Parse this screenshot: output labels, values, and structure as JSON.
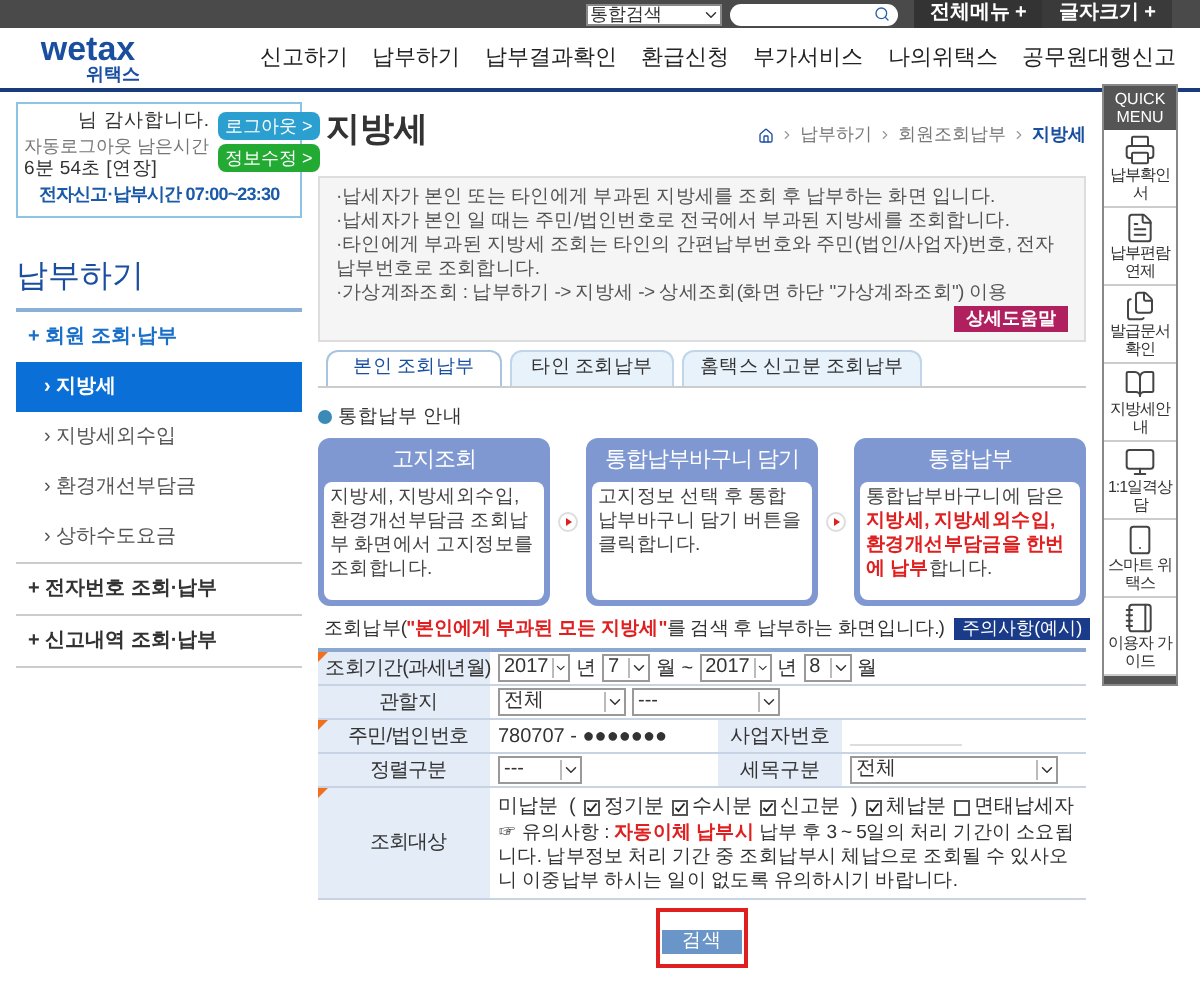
{
  "top_bar": {
    "search_scope": "통합검색",
    "buttons": [
      "전체메뉴 +",
      "글자크기 +"
    ]
  },
  "logo": {
    "text": "wetax",
    "sub": "위택스"
  },
  "nav": [
    "신고하기",
    "납부하기",
    "납부결과확인",
    "환급신청",
    "부가서비스",
    "나의위택스",
    "공무원대행신고"
  ],
  "login_box": {
    "greeting": "님 감사합니다.",
    "auto_logout": "자동로그아웃 남은시간",
    "remaining": "6분 54초 [연장]",
    "hours": "전자신고·납부시간 07:00~23:30",
    "buttons": [
      {
        "label": "로그아웃 >",
        "color": "#2a9fd0"
      },
      {
        "label": "정보수정 >",
        "color": "#22aa33"
      }
    ]
  },
  "sidebar": {
    "title": "납부하기",
    "items": [
      {
        "label": "+ 회원 조회·납부",
        "expanded": true,
        "children": [
          {
            "label": "› 지방세",
            "selected": true
          },
          {
            "label": "› 지방세외수입",
            "selected": false
          },
          {
            "label": "› 환경개선부담금",
            "selected": false
          },
          {
            "label": "› 상하수도요금",
            "selected": false
          }
        ]
      },
      {
        "label": "+ 전자번호 조회·납부",
        "expanded": false
      },
      {
        "label": "+ 신고내역 조회·납부",
        "expanded": false
      }
    ]
  },
  "page_title": "지방세",
  "breadcrumb": [
    "납부하기",
    "회원조회납부",
    "지방세"
  ],
  "info": {
    "bullets": [
      "·납세자가 본인 또는 타인에게 부과된 지방세를 조회 후 납부하는 화면 입니다.",
      "·납세자가 본인 일 때는 주민/법인번호로 전국에서 부과된 지방세를 조회합니다.",
      "·타인에게 부과된 지방세 조회는 타인의 간편납부번호와 주민(법인/사업자)번호, 전자납부번호로 조회합니다.",
      "·가상계좌조회 : 납부하기 -> 지방세 -> 상세조회(화면 하단 \"가상계좌조회\") 이용"
    ],
    "help_button": "상세도움말"
  },
  "tabs": [
    {
      "label": "본인 조회납부",
      "selected": true
    },
    {
      "label": "타인 조회납부",
      "selected": false
    },
    {
      "label": "홈택스 신고분 조회납부",
      "selected": false
    }
  ],
  "guide": {
    "title": "통합납부 안내",
    "steps": [
      {
        "title": "고지조회",
        "text": [
          {
            "t": "지방세, 지방세외수입, 환경개선부담금 조회납부 화면에서 고지정보를 조회합니다.",
            "emph": false
          }
        ]
      },
      {
        "title": "통합납부바구니 담기",
        "text": [
          {
            "t": "고지정보 선택 후 통합납부바구니 담기 버튼을 클릭합니다.",
            "emph": false
          }
        ]
      },
      {
        "title": "통합납부",
        "text": [
          {
            "t": "통합납부바구니에 담은 ",
            "emph": false
          },
          {
            "t": "지방세, 지방세외수입, 환경개선부담금을 한번에 납부",
            "emph": true
          },
          {
            "t": "합니다.",
            "emph": false
          }
        ]
      }
    ]
  },
  "form": {
    "heading": [
      {
        "t": "조회납부(",
        "emph": false
      },
      {
        "t": "\"본인에게 부과된 모든 지방세\"",
        "emph": true
      },
      {
        "t": "를 검색 후 납부하는 화면입니다.)",
        "emph": false
      }
    ],
    "notice_button": "주의사항(예시)",
    "period": {
      "label": "조회기간(과세년월)",
      "required": true,
      "from_year": "2017",
      "year_unit_1": "년",
      "from_month": "7",
      "month_unit_1": "월 ~",
      "to_year": "2017",
      "year_unit_2": "년",
      "to_month": "8",
      "month_unit_2": "월"
    },
    "jurisdiction": {
      "label": "관할지",
      "required": false,
      "values": [
        "전체",
        "---"
      ]
    },
    "id_number": {
      "label": "주민/법인번호",
      "required": true,
      "value": "780707 - ●●●●●●●",
      "business_label": "사업자번호"
    },
    "sort": {
      "label": "정렬구분",
      "required": false,
      "value": "---",
      "tax_label": "세목구분",
      "tax_value": "전체"
    },
    "target": {
      "label": "조회대상",
      "required": true,
      "options": [
        {
          "kind": "text",
          "label": "미납분  ("
        },
        {
          "kind": "checkbox",
          "label": "정기분",
          "checked": true
        },
        {
          "kind": "checkbox",
          "label": "수시분",
          "checked": true
        },
        {
          "kind": "checkbox",
          "label": "신고분  )",
          "checked": true
        },
        {
          "kind": "checkbox",
          "label": "체납분",
          "checked": true
        },
        {
          "kind": "checkbox",
          "label": "면태납세자",
          "checked": false
        }
      ],
      "note": [
        {
          "t": "☞ 유의사항 : ",
          "emph": false
        },
        {
          "t": "자동이체 납부시",
          "emph": true
        },
        {
          "t": " 납부 후 3 ~ 5일의 처리 기간이 소요됩니다. 납부정보 처리 기간 중 조회납부시 체납으로 조회될 수 있사오니 이중납부 하시는 일이 없도록 유의하시기 바랍니다.",
          "emph": false
        }
      ]
    },
    "search_button": "검색"
  },
  "quick_menu": {
    "title": "QUICK MENU",
    "items": [
      {
        "kind": "printer",
        "label": "납부확인서"
      },
      {
        "kind": "doc",
        "label": "납부편람 연제"
      },
      {
        "kind": "docs",
        "label": "발급문서확인"
      },
      {
        "kind": "book",
        "label": "지방세안내"
      },
      {
        "kind": "monitor",
        "label": "1:1일격상담"
      },
      {
        "kind": "phone",
        "label": "스마트 위택스"
      },
      {
        "kind": "guide",
        "label": "이용자 가이드"
      }
    ]
  }
}
